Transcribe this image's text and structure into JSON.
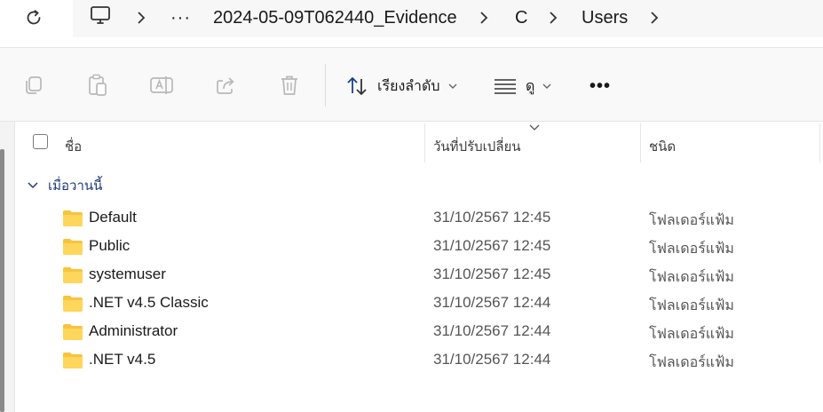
{
  "address": {
    "crumbs": [
      "2024-05-09T062440_Evidence",
      "C",
      "Users"
    ]
  },
  "toolbar": {
    "sort_label": "เรียงลำดับ",
    "view_label": "ดู",
    "more_label": "•••"
  },
  "columns": {
    "name": "ชื่อ",
    "modified": "วันที่ปรับเปลี่ยน",
    "type": "ชนิด"
  },
  "group": {
    "label": "เมื่อวานนี้"
  },
  "rows": [
    {
      "name": "Default",
      "modified": "31/10/2567 12:45",
      "type": "โฟลเดอร์แฟ้ม"
    },
    {
      "name": "Public",
      "modified": "31/10/2567 12:45",
      "type": "โฟลเดอร์แฟ้ม"
    },
    {
      "name": "systemuser",
      "modified": "31/10/2567 12:45",
      "type": "โฟลเดอร์แฟ้ม"
    },
    {
      "name": ".NET v4.5 Classic",
      "modified": "31/10/2567 12:44",
      "type": "โฟลเดอร์แฟ้ม"
    },
    {
      "name": "Administrator",
      "modified": "31/10/2567 12:44",
      "type": "โฟลเดอร์แฟ้ม"
    },
    {
      "name": ".NET v4.5",
      "modified": "31/10/2567 12:44",
      "type": "โฟลเดอร์แฟ้ม"
    }
  ],
  "colors": {
    "folder": "#F8C43D",
    "group_text": "#1D3A7A",
    "disabled_icon": "#B8B8B8"
  }
}
